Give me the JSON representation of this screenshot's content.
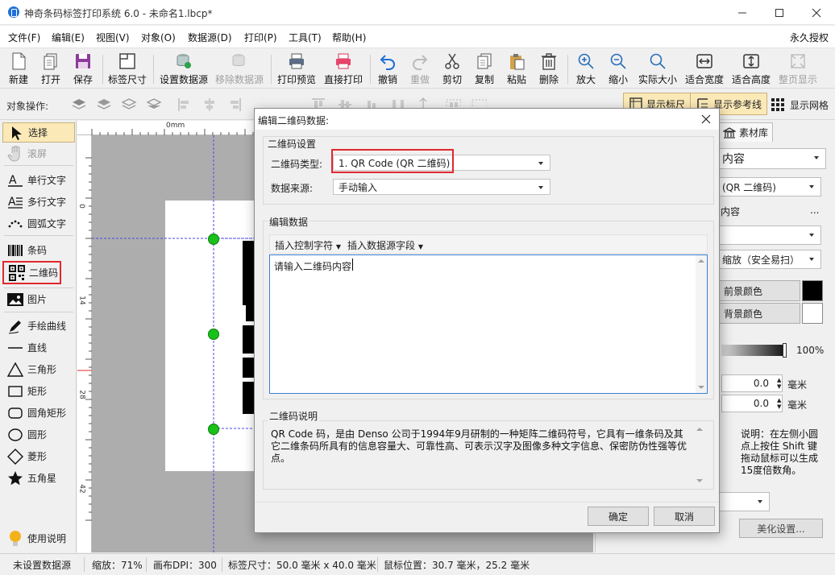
{
  "window": {
    "title": "神奇条码标签打印系统 6.0 - 未命名1.lbcp*"
  },
  "menu": [
    "文件(F)",
    "编辑(E)",
    "视图(V)",
    "对象(O)",
    "数据源(D)",
    "打印(P)",
    "工具(T)",
    "帮助(H)"
  ],
  "menu_right": "永久授权",
  "toolbar": {
    "new": "新建",
    "open": "打开",
    "save": "保存",
    "label_size": "标签尺寸",
    "set_datasource": "设置数据源",
    "remove_datasource": "移除数据源",
    "print_preview": "打印预览",
    "direct_print": "直接打印",
    "undo": "撤销",
    "redo": "重做",
    "cut": "剪切",
    "copy": "复制",
    "paste": "粘贴",
    "delete": "删除",
    "zoom_in": "放大",
    "zoom_out": "缩小",
    "actual_size": "实际大小",
    "fit_width": "适合宽度",
    "fit_height": "适合高度",
    "full_page": "整页显示"
  },
  "objbar": {
    "label": "对象操作:",
    "show_ruler": "显示标尺",
    "show_guides": "显示参考线",
    "show_grid": "显示网格"
  },
  "palette": {
    "select": "选择",
    "scroll": "滚屏",
    "single_text": "单行文字",
    "multi_text": "多行文字",
    "arc_text": "圆弧文字",
    "barcode": "条码",
    "qrcode": "二维码",
    "image": "图片",
    "freehand": "手绘曲线",
    "line": "直线",
    "triangle": "三角形",
    "rect": "矩形",
    "round_rect": "圆角矩形",
    "circle": "圆形",
    "diamond": "菱形",
    "star": "五角星",
    "help": "使用说明"
  },
  "ruler": {
    "top_zero": "0mm",
    "left_marks": [
      "0",
      "14",
      "28",
      "42"
    ]
  },
  "rpanel": {
    "tab": "素材库",
    "content_select": "内容",
    "type_select": "(QR 二维码)",
    "content_label": "内容",
    "content_more": "...",
    "scale_select": "缩放（安全易扫）",
    "fg_color": "前景颜色",
    "bg_color": "背景颜色",
    "opacity": "100%",
    "spin1_value": "0.0",
    "spin1_unit": "毫米",
    "spin2_value": "0.0",
    "spin2_unit": "毫米",
    "note": "说明：在左侧小圆点上按住 Shift 键拖动鼠标可以生成15度倍数角。",
    "beautify": "美化设置..."
  },
  "dialog": {
    "title": "编辑二维码数据:",
    "group1": "二维码设置",
    "type_label": "二维码类型:",
    "type_value": "1.  QR Code (QR 二维码)",
    "source_label": "数据来源:",
    "source_value": "手动输入",
    "group2": "编辑数据",
    "insert_ctrl": "插入控制字符",
    "insert_field": "插入数据源字段",
    "text_value": "请输入二维码内容",
    "group3": "二维码说明",
    "desc": "QR Code 码，是由 Denso 公司于1994年9月研制的一种矩阵二维码符号，它具有一维条码及其它二维条码所具有的信息容量大、可靠性高、可表示汉字及图像多种文字信息、保密防伪性强等优点。",
    "ok": "确定",
    "cancel": "取消"
  },
  "status": {
    "datasource": "未设置数据源",
    "zoom": "缩放：71%",
    "dpi": "画布DPI：300",
    "label_size": "标签尺寸：50.0 毫米 x 40.0 毫米",
    "mouse": "鼠标位置：30.7 毫米，25.2 毫米"
  },
  "colors": {
    "accent": "#1e6fd9",
    "highlight": "#fbe9b7",
    "handle": "#19c219",
    "redbox": "#e0282e"
  }
}
